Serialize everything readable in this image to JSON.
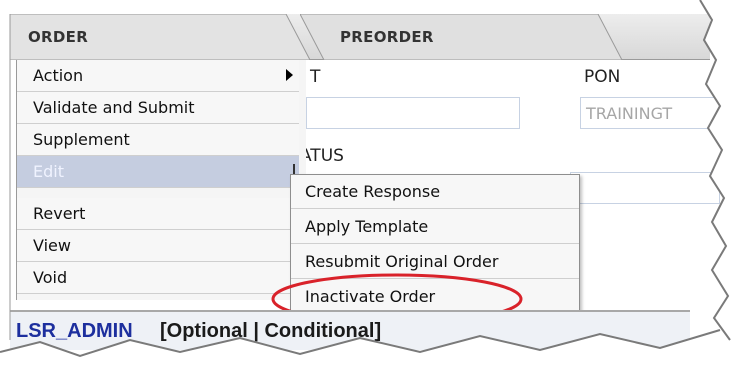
{
  "tabs": [
    {
      "label": "ORDER"
    },
    {
      "label": "PREORDER"
    }
  ],
  "form": {
    "label_partial_1": "T",
    "label_pon": "PON",
    "pon_value": "TRAININGT",
    "label_status_partial": "ATUS"
  },
  "menu": {
    "items": [
      {
        "label": "Action"
      },
      {
        "label": "Validate and Submit"
      },
      {
        "label": "Supplement"
      },
      {
        "label": "Edit"
      },
      {
        "label": "Revert"
      },
      {
        "label": "View"
      },
      {
        "label": "Void"
      }
    ]
  },
  "submenu": {
    "items": [
      {
        "label": "Create Response"
      },
      {
        "label": "Apply Template"
      },
      {
        "label": "Resubmit Original Order"
      },
      {
        "label": "Inactivate Order"
      }
    ]
  },
  "section": {
    "name": "LSR_ADMIN",
    "options": "[Optional | Conditional]"
  },
  "colors": {
    "active_menu_bg": "#c5cde0",
    "highlight_oval": "#d9222a",
    "section_name": "#1d2f9e"
  }
}
